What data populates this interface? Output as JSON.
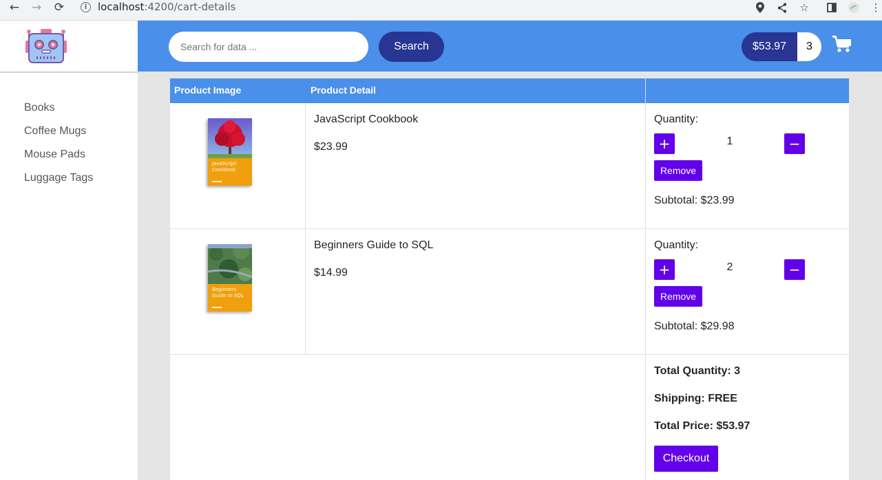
{
  "browser": {
    "url_host": "localhost",
    "url_path": ":4200/cart-details"
  },
  "header": {
    "search_placeholder": "Search for data ...",
    "search_label": "Search",
    "cart_total": "$53.97",
    "cart_quantity": "3"
  },
  "sidebar": {
    "items": [
      {
        "label": "Books"
      },
      {
        "label": "Coffee Mugs"
      },
      {
        "label": "Mouse Pads"
      },
      {
        "label": "Luggage Tags"
      }
    ]
  },
  "table": {
    "headers": [
      "Product Image",
      "Product Detail",
      ""
    ],
    "rows": [
      {
        "name": "JavaScript Cookbook",
        "price": "$23.99",
        "quantity_label": "Quantity:",
        "quantity": "1",
        "plus": "+",
        "minus": "−",
        "remove_label": "Remove",
        "subtotal": "Subtotal: $23.99",
        "cover_title": "JavaScript Cookbook"
      },
      {
        "name": "Beginners Guide to SQL",
        "price": "$14.99",
        "quantity_label": "Quantity:",
        "quantity": "2",
        "plus": "+",
        "minus": "−",
        "remove_label": "Remove",
        "subtotal": "Subtotal: $29.98",
        "cover_title": "Beginners Guide to SQL"
      }
    ]
  },
  "summary": {
    "total_quantity": "Total Quantity: 3",
    "shipping": "Shipping: FREE",
    "total_price": "Total Price: $53.97",
    "checkout_label": "Checkout"
  },
  "colors": {
    "header_blue": "#4a8fe9",
    "navy": "#283593",
    "purple": "#6200ea"
  }
}
